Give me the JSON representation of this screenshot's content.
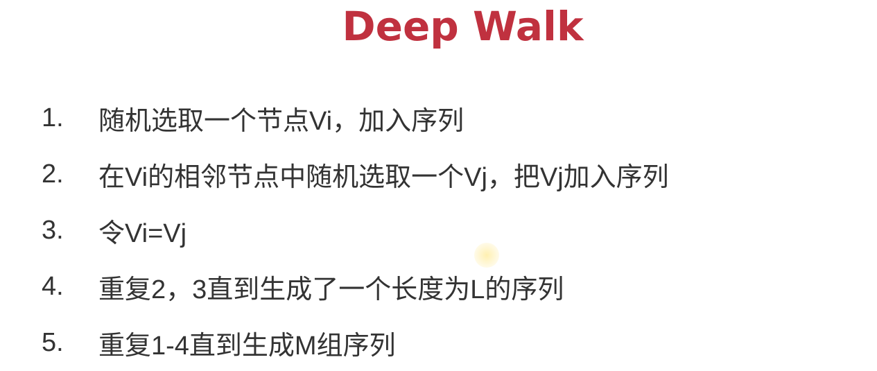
{
  "slide": {
    "title": "Deep Walk",
    "title_color": "#c0313f",
    "text_color": "#333333",
    "steps": [
      {
        "number": "1.",
        "text": "随机选取一个节点Vi，加入序列"
      },
      {
        "number": "2.",
        "text": "在Vi的相邻节点中随机选取一个Vj，把Vj加入序列"
      },
      {
        "number": "3.",
        "text": "令Vi=Vj"
      },
      {
        "number": "4.",
        "text": "重复2，3直到生成了一个长度为L的序列"
      },
      {
        "number": "5.",
        "text": "重复1-4直到生成M组序列"
      }
    ]
  }
}
